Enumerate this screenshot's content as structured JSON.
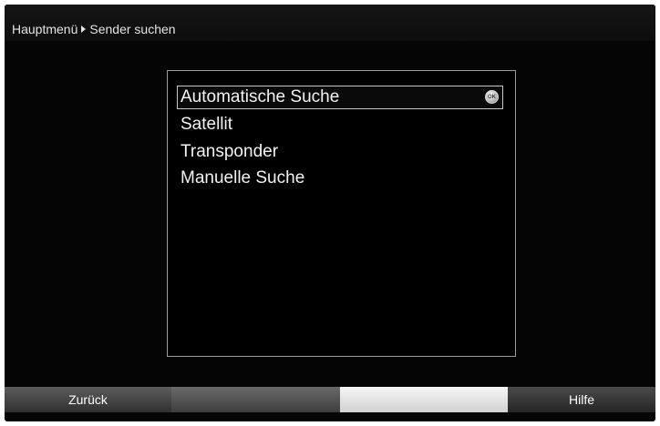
{
  "header": {
    "breadcrumb": [
      "Hauptmenü",
      "Sender suchen"
    ]
  },
  "menu": {
    "items": [
      {
        "label": "Automatische Suche",
        "selected": true,
        "icon": "ok-button-icon"
      },
      {
        "label": "Satellit"
      },
      {
        "label": "Transponder"
      },
      {
        "label": "Manuelle Suche"
      }
    ]
  },
  "footer": {
    "back_label": "Zurück",
    "help_label": "Hilfe",
    "colors": [
      "#3e3e3e",
      "#5a5a5a",
      "#e6e6e6",
      "#333333"
    ]
  }
}
